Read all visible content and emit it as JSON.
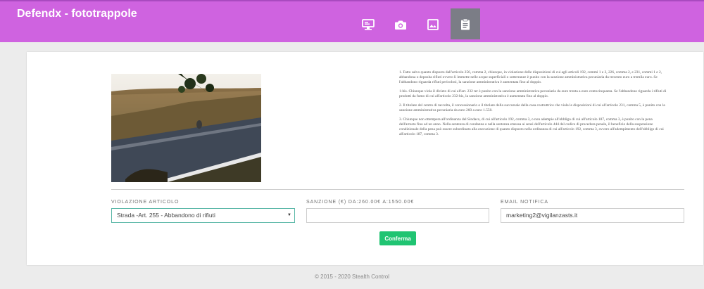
{
  "app": {
    "title": "Defendx - fototrappole"
  },
  "nav": {
    "items": [
      {
        "icon": "monitor-icon"
      },
      {
        "icon": "camera-icon"
      },
      {
        "icon": "image-icon"
      },
      {
        "icon": "clipboard-icon",
        "active": true
      }
    ]
  },
  "legal": {
    "paragraphs": [
      "1. Fatto salvo quanto disposto dall'articolo 256, comma 2, chiunque, in violazione delle disposizioni di cui agli articoli 192, commi 1 e 2, 226, comma 2, e 231, commi 1 e 2, abbandona o deposita rifiuti ovvero li immette nelle acque superficiali o sotterranee è punito con la sanzione amministrativa pecuniaria da trecento euro a tremila euro. Se l'abbandono riguarda rifiuti pericolosi, la sanzione amministrativa è aumentata fino al doppio.",
      "1-bis. Chiunque viola il divieto di cui all'art. 232 ter è punito con la sanzione amministrativa pecuniaria da euro trenta a euro centocinquanta. Se l'abbandono riguarda i rifiuti di prodotti da fumo di cui all'articolo 232-bis, la sanzione amministrativa è aumentata fino al doppio.",
      "2. Il titolare del centro di raccolta, il concessionario o il titolare della succursale della casa costruttrice che viola le disposizioni di cui all'articolo 231, comma 5, è punito con la sanzione amministrativa pecuniaria da euro 260 a euro 1.550.",
      "3. Chiunque non ottempera all'ordinanza del Sindaco, di cui all'articolo 192, comma 3, o non adempie all'obbligo di cui all'articolo 187, comma 3, è punito con la pena dell'arresto fino ad un anno. Nella sentenza di condanna o nella sentenza emessa ai sensi dell'articolo 444 del codice di procedura penale, il beneficio della sospensione condizionale della pena può essere subordinato alla esecuzione di quanto disposto nella ordinanza di cui all'articolo 192, comma 3, ovvero all'adempimento dell'obbligo di cui all'articolo 187, comma 3."
    ]
  },
  "form": {
    "violation": {
      "label": "VIOLAZIONE ARTICOLO",
      "value": "Strada -Art. 255 - Abbandono di rifiuti"
    },
    "fine": {
      "label": "SANZIONE (€) DA:260.00€ A:1550.00€",
      "value": ""
    },
    "email": {
      "label": "EMAIL NOTIFICA",
      "value": "marketing2@vigilanzasts.it"
    },
    "confirm_label": "Conferma"
  },
  "footer": {
    "text": "© 2015 - 2020 Stealth Control"
  },
  "colors": {
    "topbar": "#cf63e0",
    "active_nav": "#7b7d86",
    "confirm": "#20c472"
  }
}
